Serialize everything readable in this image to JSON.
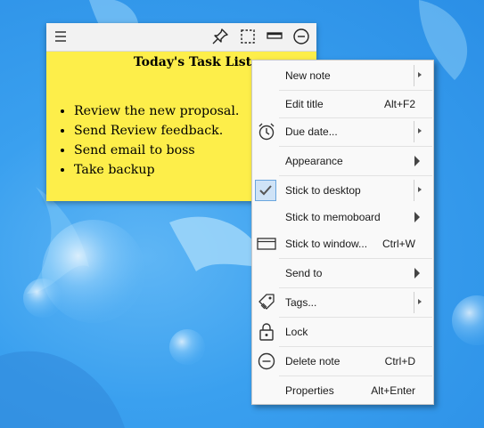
{
  "note": {
    "title": "Today's Task List",
    "tasks": [
      "Review the new proposal.",
      "Send Review feedback.",
      "Send email to boss",
      "Take backup"
    ],
    "color": "#fdee4a",
    "toolbar_icons": [
      "menu-icon",
      "pin-icon",
      "select-icon",
      "rollup-icon",
      "minus-circle-icon"
    ]
  },
  "menu": {
    "new_note": "New note",
    "edit_title": "Edit title",
    "edit_title_shortcut": "Alt+F2",
    "due_date": "Due date...",
    "appearance": "Appearance",
    "stick_desktop": "Stick to desktop",
    "stick_memoboard": "Stick to memoboard",
    "stick_window": "Stick to window...",
    "stick_window_shortcut": "Ctrl+W",
    "send_to": "Send to",
    "tags": "Tags...",
    "lock": "Lock",
    "delete_note": "Delete note",
    "delete_note_shortcut": "Ctrl+D",
    "properties": "Properties",
    "properties_shortcut": "Alt+Enter"
  }
}
